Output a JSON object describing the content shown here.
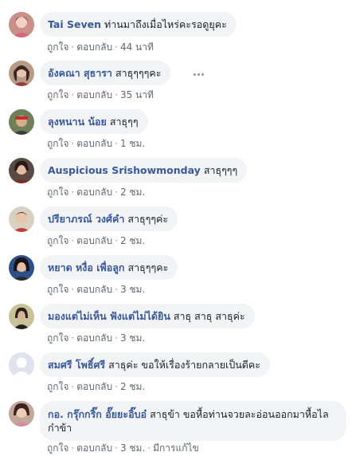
{
  "comments": [
    {
      "author": "Tai Seven",
      "text": "ท่านมาถึงเมื่อไหร่คะรอดูยุคะ",
      "like": "ถูกใจ",
      "reply": "ตอบกลับ",
      "time": "44 นาที"
    },
    {
      "author": "อังคณา สุธารา",
      "text": "สาธุๆๆๆคะ",
      "like": "ถูกใจ",
      "reply": "ตอบกลับ",
      "time": "35 นาที"
    },
    {
      "author": "ลุงหนาน น้อย",
      "text": "สาธุๆๆ",
      "like": "ถูกใจ",
      "reply": "ตอบกลับ",
      "time": "1 ชม."
    },
    {
      "author": "Auspicious Srishowmonday",
      "text": "สาธุๆๆๆ",
      "like": "ถูกใจ",
      "reply": "ตอบกลับ",
      "time": "2 ชม."
    },
    {
      "author": "ปรียาภรณ์ วงศ์คำ",
      "text": "สาธุๆๆค่ะ",
      "like": "ถูกใจ",
      "reply": "ตอบกลับ",
      "time": "2 ชม."
    },
    {
      "author": "หยาด หงื่อ เพื่อลูก",
      "text": "สาธุๆๆคะ",
      "like": "ถูกใจ",
      "reply": "ตอบกลับ",
      "time": "3 ชม."
    },
    {
      "author": "มองแต่ไม่เห็น ฟังแต่ไม่ได้ยิน",
      "text": "สาธุ สาธุ สาธุค่ะ",
      "like": "ถูกใจ",
      "reply": "ตอบกลับ",
      "time": "3 ชม."
    },
    {
      "author": "สมศรี โพธิ์ศรี",
      "text": "สาธุค่ะ ขอให้เรื่องร้ายกลายเป็นดีคะ",
      "like": "ถูกใจ",
      "reply": "ตอบกลับ",
      "time": "2 ชม."
    },
    {
      "author": "กอ. กรุ๊กกริ๊ก อั๊ยยะอิ๊บอ๋",
      "text": "สาธุข้า ขอหื้อท่านจวยละอ่อนออกมาหื้อไลก๋าข้า",
      "like": "ถูกใจ",
      "reply": "ตอบกลับ",
      "time": "3 ชม.",
      "edited": "มีการแก้ไข"
    }
  ],
  "colors": {
    "author": "#385898",
    "bubble": "#f2f3f5",
    "meta": "#606770"
  }
}
